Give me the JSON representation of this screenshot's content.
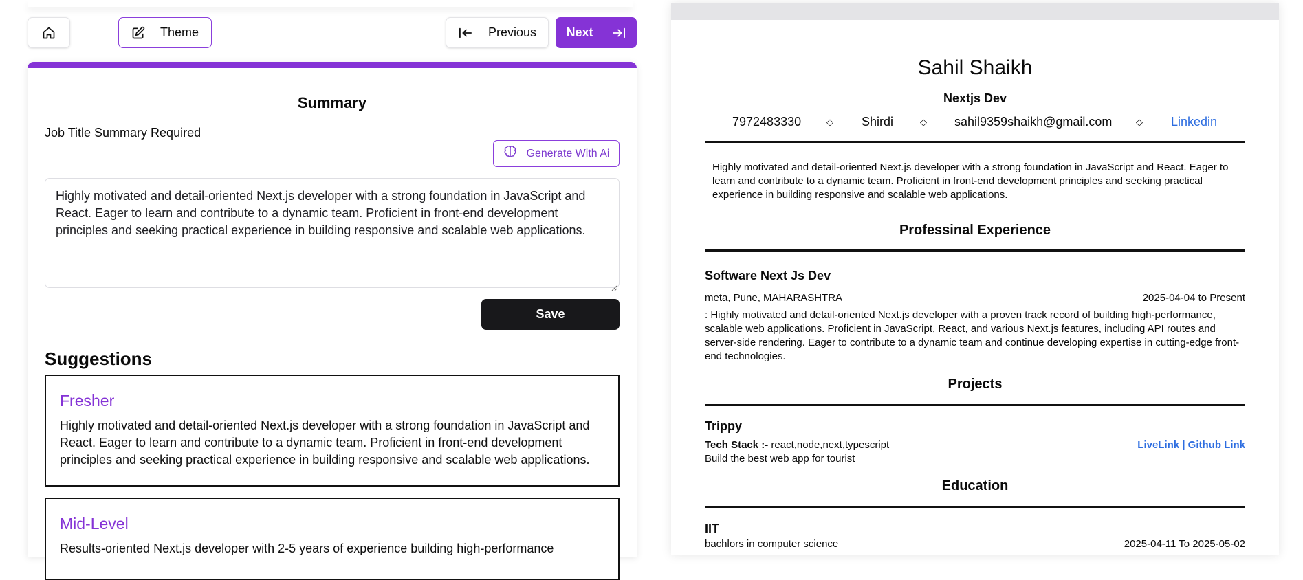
{
  "toolbar": {
    "theme_label": "Theme",
    "previous_label": "Previous",
    "next_label": "Next"
  },
  "editor": {
    "title": "Summary",
    "subtitle": "Job Title Summary Required",
    "generate_label": "Generate With Ai",
    "summary_text": "Highly motivated and detail-oriented Next.js developer with a strong foundation in JavaScript and React.  Eager to learn and contribute to a dynamic team. Proficient in front-end development principles and seeking practical experience in building responsive and scalable web applications.",
    "save_label": "Save",
    "suggestions_title": "Suggestions",
    "suggestions": [
      {
        "level": "Fresher",
        "text": "Highly motivated and detail-oriented Next.js developer with a strong foundation in JavaScript and React. Eager to learn and contribute to a dynamic team. Proficient in front-end development principles and seeking practical experience in building responsive and scalable web applications."
      },
      {
        "level": "Mid-Level",
        "text": "Results-oriented Next.js developer with 2-5 years of experience building high-performance"
      }
    ]
  },
  "preview": {
    "name": "Sahil Shaikh",
    "role": "Nextjs Dev",
    "phone": "7972483330",
    "location": "Shirdi",
    "email": "sahil9359shaikh@gmail.com",
    "linkedin": "Linkedin",
    "separator": "◇",
    "summary": "Highly motivated and detail-oriented Next.js developer with a strong foundation in JavaScript and React. Eager to learn and contribute to a dynamic team. Proficient in front-end development principles and seeking practical experience in building responsive and scalable web applications.",
    "experience_heading": "Professinal Experience",
    "experience": {
      "title": "Software Next Js Dev",
      "company": "meta, Pune, MAHARASHTRA",
      "dates": "2025-04-04 to Present",
      "description": ": Highly motivated and detail-oriented Next.js developer with a proven track record of building high-performance, scalable web applications. Proficient in JavaScript, React, and various Next.js features, including API routes and server-side rendering. Eager to contribute to a dynamic team and continue developing expertise in cutting-edge front-end technologies."
    },
    "projects_heading": "Projects",
    "project": {
      "name": "Trippy",
      "tech_label": "Tech Stack :-",
      "tech": " react,node,next,typescript",
      "links": "LiveLink | Github Link",
      "description": "Build the best web app for tourist"
    },
    "education_heading": "Education",
    "education": {
      "school": "IIT",
      "degree": "bachlors in computer science",
      "dates": "2025-04-11 To 2025-05-02"
    }
  }
}
